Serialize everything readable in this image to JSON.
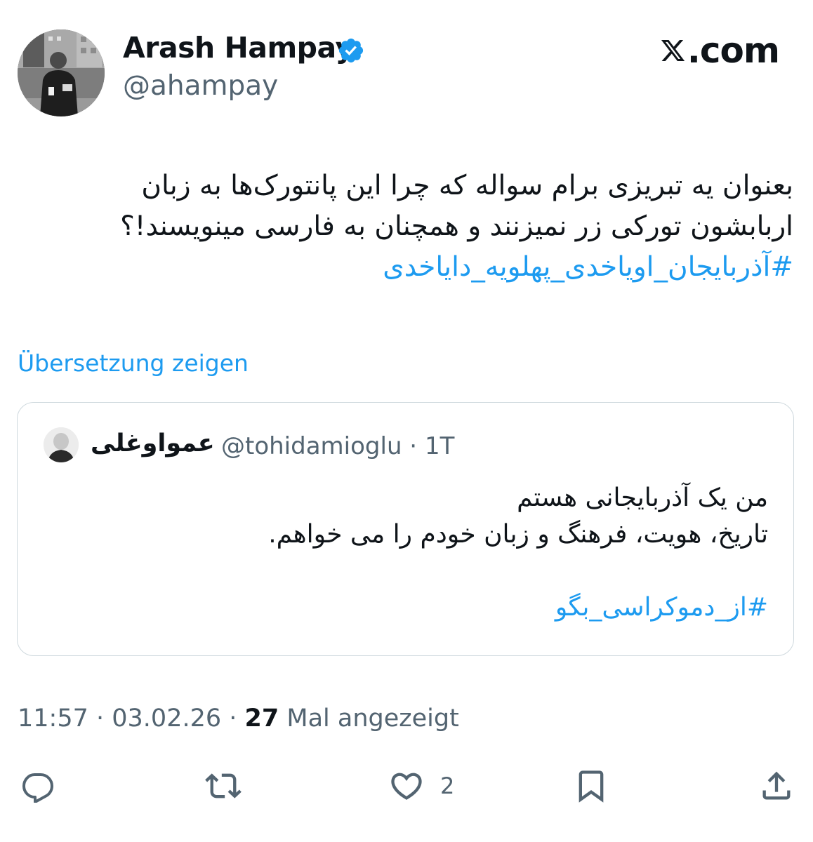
{
  "author": {
    "display_name": "Arash Hampay",
    "handle": "@ahampay",
    "verified": true
  },
  "brand": {
    "label": ".com"
  },
  "tweet": {
    "lines": [
      "بعنوان یه تبریزی برام سواله که چرا این پانتورک‌ها به زبان",
      "اربابشون تورکی زر نمیزنند و همچنان به فارسی مینویسند!؟"
    ],
    "hashtag": "#آذربایجان_اویاخدی_پهلویه_دایاخدی"
  },
  "translate_link": "Übersetzung zeigen",
  "quoted_tweet": {
    "display_name": "عمواوغلی",
    "handle": "@tohidamioglu",
    "time": "1T",
    "lines": [
      "من یک آذربایجانی هستم",
      "تاریخ، هویت، فرهنگ و زبان خودم را می خواهم."
    ],
    "hashtag": "#از_دموکراسی_بگو"
  },
  "meta": {
    "time": "11:57",
    "date": "03.02.26",
    "views_count": "27",
    "views_label": "Mal angezeigt"
  },
  "actions": {
    "like_count": "2",
    "icons": [
      "reply-icon",
      "retweet-icon",
      "like-icon",
      "bookmark-icon",
      "share-icon"
    ]
  },
  "colors": {
    "link": "#1d9bf0",
    "secondary_text": "#536471",
    "primary_text": "#0f1419",
    "border": "#cfd9de"
  }
}
